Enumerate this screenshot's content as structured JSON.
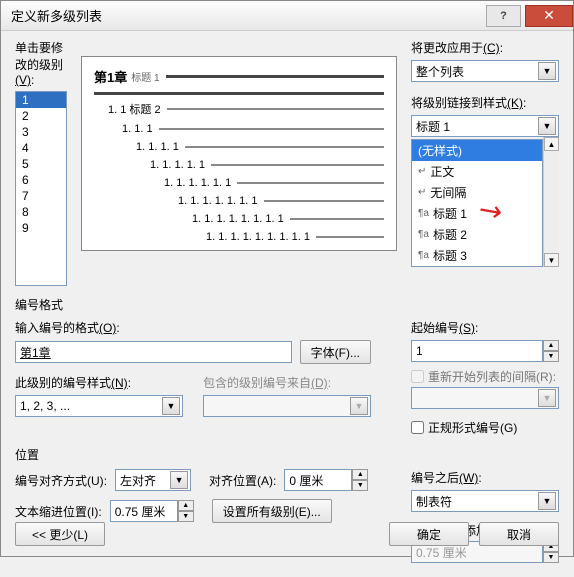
{
  "title": "定义新多级列表",
  "level_label_pre": "单击要修改的级别",
  "level_label_key": "(V)",
  "levels": [
    "1",
    "2",
    "3",
    "4",
    "5",
    "6",
    "7",
    "8",
    "9"
  ],
  "selected_level": "1",
  "preview": {
    "line1_num": "第1章",
    "line1_sub": "标题 1",
    "lines": [
      "1. 1 标题 2",
      "1. 1. 1",
      "1. 1. 1. 1",
      "1. 1. 1. 1. 1",
      "1. 1. 1. 1. 1. 1",
      "1. 1. 1. 1. 1. 1. 1",
      "1. 1. 1. 1. 1. 1. 1. 1",
      "1. 1. 1. 1. 1. 1. 1. 1. 1"
    ]
  },
  "apply_to_label_pre": "将更改应用于",
  "apply_to_label_key": "(C)",
  "apply_to_value": "整个列表",
  "link_style_label_pre": "将级别链接到样式",
  "link_style_label_key": "(K)",
  "link_style_value": "标题 1",
  "style_options": [
    "(无样式)",
    "正文",
    "无间隔",
    "标题 1",
    "标题 2",
    "标题 3"
  ],
  "numfmt_group": "编号格式",
  "numfmt_label_pre": "输入编号的格式",
  "numfmt_label_key": "(O)",
  "numfmt_value": "第1章",
  "font_btn_pre": "字体",
  "font_btn_key": "(F)",
  "start_label_pre": "起始编号",
  "start_label_key": "(S)",
  "start_value": "1",
  "restart_label_pre": "重新开始列表的间隔",
  "restart_label_key": "(R)",
  "numstyle_label_pre": "此级别的编号样式",
  "numstyle_label_key": "(N)",
  "numstyle_value": "1, 2, 3, ...",
  "include_label_pre": "包含的级别编号来自",
  "include_label_key": "(D)",
  "legal_label_pre": "正规形式编号",
  "legal_label_key": "(G)",
  "pos_group": "位置",
  "align_label_pre": "编号对齐方式",
  "align_label_key": "(U)",
  "align_value": "左对齐",
  "alignat_label_pre": "对齐位置",
  "alignat_label_key": "(A)",
  "alignat_value": "0 厘米",
  "follow_label_pre": "编号之后",
  "follow_label_key": "(W)",
  "follow_value": "制表符",
  "indent_label_pre": "文本缩进位置",
  "indent_label_key": "(I)",
  "indent_value": "0.75 厘米",
  "setall_btn_pre": "设置所有级别",
  "setall_btn_key": "(E)",
  "tabstop_label_pre": "制表位添加位置",
  "tabstop_label_key": "(B)",
  "tabstop_value": "0.75 厘米",
  "less_btn_pre": "<< 更少",
  "less_btn_key": "(L)",
  "ok_btn": "确定",
  "cancel_btn": "取消",
  "colon": ":"
}
